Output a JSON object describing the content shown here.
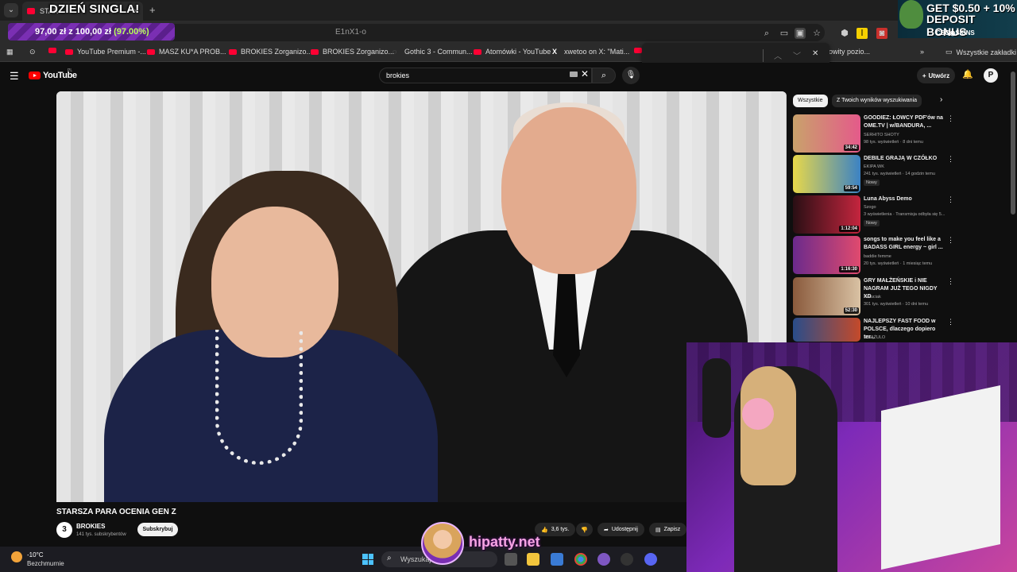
{
  "browser": {
    "active_tab_title": "STAR",
    "url_fragment": "E1nX1-o",
    "new_tab_symbol": "+",
    "tab_close_symbol": "×"
  },
  "bookmarks": [
    {
      "label": "YouTube Premium -..."
    },
    {
      "label": "MASZ KU*A PROB..."
    },
    {
      "label": "BROKIES Zorganizo..."
    },
    {
      "label": "BROKIES Zorganizo..."
    },
    {
      "label": "Gothic 3 - Commun..."
    },
    {
      "label": "Atomówki - YouTube"
    },
    {
      "label": "xwetoo on X: \"Mati..."
    },
    {
      "label": "owity pozio..."
    }
  ],
  "bookmarks_all_label": "Wszystkie zakładki",
  "overlays": {
    "banner": "DZIEŃ SINGLA!",
    "donation_amount": "97,00 zł z 100,00 zł",
    "donation_pct": "(97.00%)",
    "csgo_line1": "GET $0.50 + 10%",
    "csgo_line2": "DEPOSIT BONUS",
    "csgo_logo": "CSG◉SKINS",
    "watermark": "hipatty.net"
  },
  "youtube": {
    "logo_text": "YouTube",
    "region": "PL",
    "search_value": "brokies",
    "create_label": "Utwórz",
    "avatar_letter": "P"
  },
  "video": {
    "title": "STARSZA PARA OCENIA GEN Z",
    "channel": "BROKIES",
    "channel_avatar": "3",
    "subscribers": "141 tys. subskrybentów",
    "subscribe_label": "Subskrybuj",
    "likes": "3,6 tys.",
    "share_label": "Udostępnij",
    "save_label": "Zapisz"
  },
  "filter_chips": {
    "all": "Wszystkie",
    "related": "Z Twoich wyników wyszukiwania"
  },
  "recommendations": [
    {
      "title": "GOODIEZ: ŁOWCY PDF'ów na OME.TV | w/BANDURA, ...",
      "channel": "SERHITO SHOTY",
      "meta": "98 tys. wyświetleń · 8 dni temu",
      "duration": "34:42",
      "badge": ""
    },
    {
      "title": "DEBILE GRAJĄ W CZÓŁKO",
      "channel": "EKIPA WK",
      "meta": "241 tys. wyświetleń · 14 godzin temu",
      "duration": "59:54",
      "badge": "Nowy"
    },
    {
      "title": "Luna Abyss Demo",
      "channel": "Szogo",
      "meta": "3 wyświetlenia · Transmisja odbyła się 5...",
      "duration": "1:12:04",
      "badge": "Nowy"
    },
    {
      "title": "songs to make you feel like a BADASS GIRL energy ~ girl ...",
      "channel": "baddie femme",
      "meta": "20 tys. wyświetleń · 1 miesiąc temu",
      "duration": "1:16:30",
      "badge": ""
    },
    {
      "title": "GRY MAŁŻEŃSKIE i NIE NAGRAM JUŻ TEGO NIGDY XD",
      "channel": "Naruciak",
      "meta": "301 tys. wyświetleń · 10 dni temu",
      "duration": "52:30",
      "badge": ""
    },
    {
      "title": "NAJLEPSZY FAST FOOD w POLSCE, dlaczego dopiero ter...",
      "channel": "KSIĄŻULO",
      "meta": "",
      "duration": "",
      "badge": ""
    }
  ],
  "taskbar": {
    "temperature": "-10°C",
    "weather": "Bezchmurnie",
    "search_placeholder": "Wyszukaj"
  },
  "colors": {
    "youtube_red": "#ff0000",
    "background": "#0f0f0f",
    "donation_purple": "#7a2fb3",
    "watermark_pink": "#f6a4e3"
  }
}
